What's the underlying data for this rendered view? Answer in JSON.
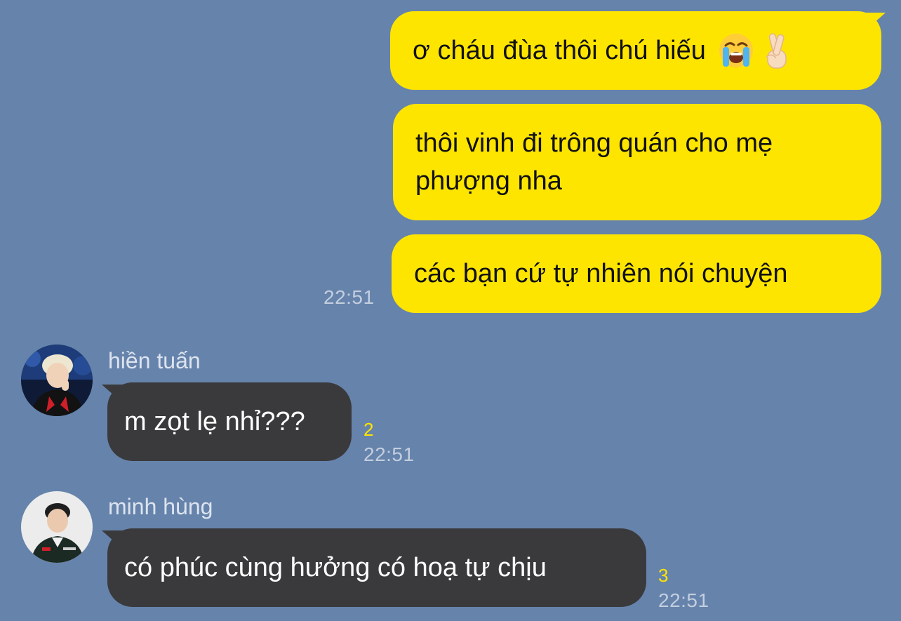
{
  "colors": {
    "background": "#6683AB",
    "outgoing_bubble": "#FEE500",
    "incoming_bubble": "#3A3A3C",
    "unread_count": "#FEE500"
  },
  "outgoing_messages": [
    {
      "text": "ơ cháu đùa thôi chú hiếu",
      "emojis": [
        "loudly-crying-face-icon",
        "crossed-fingers-icon"
      ]
    },
    {
      "text": "thôi vinh đi trông quán cho mẹ phượng nha"
    },
    {
      "text": "các bạn cứ tự nhiên nói chuyện",
      "time": "22:51"
    }
  ],
  "incoming_messages": [
    {
      "sender": "hiền tuấn",
      "text": "m zọt lẹ nhỉ???",
      "unread": "2",
      "time": "22:51"
    },
    {
      "sender": "minh hùng",
      "text": "có phúc cùng hưởng có hoạ tự chịu",
      "unread": "3",
      "time": "22:51"
    }
  ]
}
